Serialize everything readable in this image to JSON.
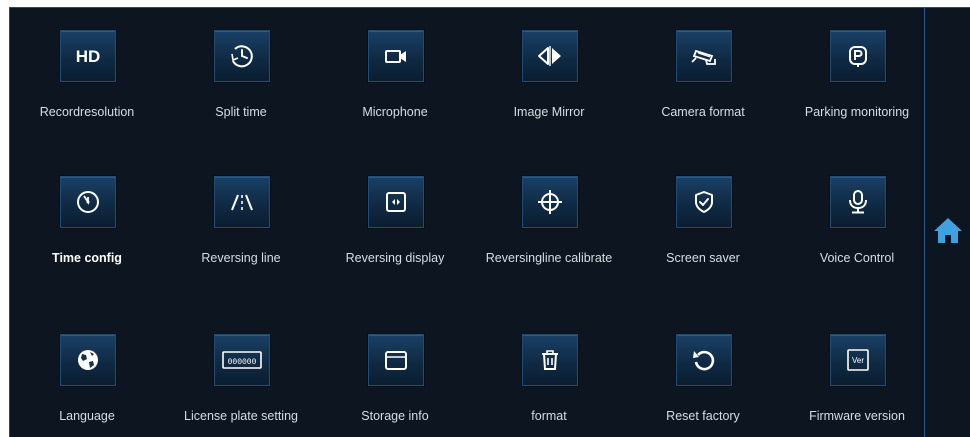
{
  "menu": {
    "items": [
      {
        "label": "Recordresolution",
        "icon": "hd-icon"
      },
      {
        "label": "Split time",
        "icon": "clock-icon"
      },
      {
        "label": "Microphone",
        "icon": "camcorder-icon"
      },
      {
        "label": "Image Mirror",
        "icon": "mirror-icon"
      },
      {
        "label": "Camera format",
        "icon": "security-camera-icon"
      },
      {
        "label": "Parking monitoring",
        "icon": "parking-icon"
      },
      {
        "label": "Time config",
        "icon": "stopwatch-icon"
      },
      {
        "label": "Reversing line",
        "icon": "reversing-line-icon"
      },
      {
        "label": "Reversing display",
        "icon": "display-icon"
      },
      {
        "label": "Reversingline calibrate",
        "icon": "crosshair-icon"
      },
      {
        "label": "Screen saver",
        "icon": "shield-check-icon"
      },
      {
        "label": "Voice Control",
        "icon": "microphone-icon"
      },
      {
        "label": "Language",
        "icon": "globe-icon"
      },
      {
        "label": "License plate setting",
        "icon": "license-plate-icon"
      },
      {
        "label": "Storage info",
        "icon": "folder-icon"
      },
      {
        "label": "format",
        "icon": "trash-icon"
      },
      {
        "label": "Reset factory",
        "icon": "reset-icon"
      },
      {
        "label": "Firmware version",
        "icon": "version-icon"
      }
    ],
    "icon_text": {
      "hd": "HD",
      "plate": "000000",
      "ver": "Ver"
    }
  },
  "sidebar": {
    "home_icon": "home-icon"
  },
  "colors": {
    "background": "#0c1520",
    "tile_top": "#1a4066",
    "tile_bottom": "#0b1d30",
    "border": "#1f5a8a",
    "label": "#d6dde4",
    "home": "#3fa1dd"
  }
}
